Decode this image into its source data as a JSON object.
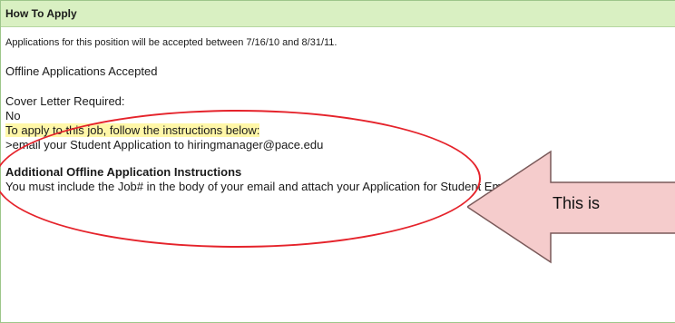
{
  "panel": {
    "title": "How To Apply",
    "accept_text": "Applications for this position will be accepted between 7/16/10 and 8/31/11.",
    "offline_title": "Offline Applications Accepted",
    "cover_letter_label": "Cover Letter Required:",
    "cover_letter_value": "No",
    "instructions_intro": "To apply to this job, follow the instructions below:",
    "instructions_email": ">email your Student Application to hiringmanager@pace.edu",
    "additional_title": "Additional Offline Application Instructions",
    "additional_text": "You must include the Job# in the body of your email and attach your Application for Student Employment to the email."
  },
  "annotation": {
    "callout_text": "This is",
    "ellipse_color": "#e5232b",
    "arrow_fill": "#f5cccc"
  },
  "colors": {
    "header_bg": "#d9f0c2",
    "border": "#9dc68a",
    "highlight": "#fff7a8"
  }
}
